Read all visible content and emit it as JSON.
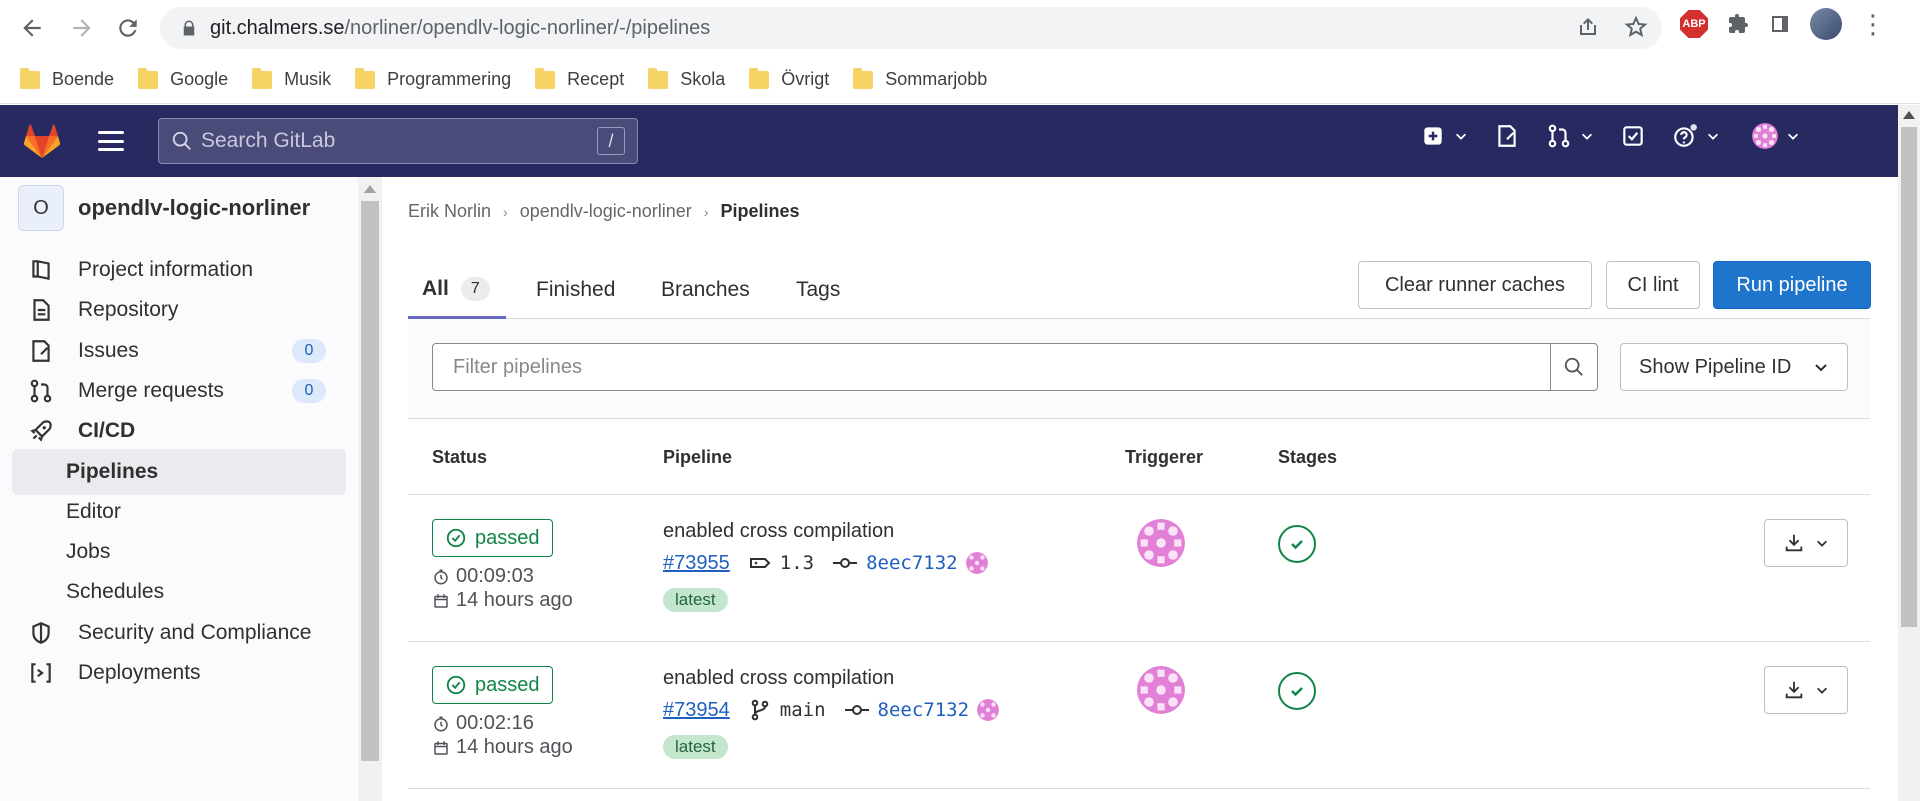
{
  "browser": {
    "url_host": "git.chalmers.se",
    "url_path": "/norliner/opendlv-logic-norliner/-/pipelines",
    "bookmarks": [
      "Boende",
      "Google",
      "Musik",
      "Programmering",
      "Recept",
      "Skola",
      "Övrigt",
      "Sommarjobb"
    ],
    "abp_label": "ABP"
  },
  "header": {
    "search_placeholder": "Search GitLab",
    "search_shortcut": "/"
  },
  "sidebar": {
    "project_initial": "O",
    "project_name": "opendlv-logic-norliner",
    "items": [
      {
        "label": "Project information",
        "icon": "project-icon"
      },
      {
        "label": "Repository",
        "icon": "doc-icon"
      },
      {
        "label": "Issues",
        "icon": "issues-icon",
        "count": "0"
      },
      {
        "label": "Merge requests",
        "icon": "merge-request-icon",
        "count": "0"
      },
      {
        "label": "CI/CD",
        "icon": "rocket-icon"
      }
    ],
    "cicd_sub": [
      "Pipelines",
      "Editor",
      "Jobs",
      "Schedules"
    ],
    "more_items": [
      {
        "label": "Security and Compliance",
        "icon": "shield-icon"
      },
      {
        "label": "Deployments",
        "icon": "deployments-icon"
      }
    ]
  },
  "breadcrumb": [
    "Erik Norlin",
    "opendlv-logic-norliner",
    "Pipelines"
  ],
  "tabs": {
    "all": "All",
    "all_count": "7",
    "finished": "Finished",
    "branches": "Branches",
    "tags": "Tags"
  },
  "actions": {
    "clear_caches": "Clear runner caches",
    "ci_lint": "CI lint",
    "run_pipeline": "Run pipeline"
  },
  "filter": {
    "placeholder": "Filter pipelines",
    "show_id": "Show Pipeline ID"
  },
  "table": {
    "headers": [
      "Status",
      "Pipeline",
      "Triggerer",
      "Stages"
    ],
    "rows": [
      {
        "status": "passed",
        "duration": "00:09:03",
        "finished": "14 hours ago",
        "commit_title": "enabled cross compilation",
        "pipeline_id": "#73955",
        "ref_type": "tag",
        "ref": "1.3",
        "sha": "8eec7132",
        "badge": "latest"
      },
      {
        "status": "passed",
        "duration": "00:02:16",
        "finished": "14 hours ago",
        "commit_title": "enabled cross compilation",
        "pipeline_id": "#73954",
        "ref_type": "branch",
        "ref": "main",
        "sha": "8eec7132",
        "badge": "latest"
      }
    ]
  },
  "colors": {
    "header_bg": "#292961",
    "success": "#108548",
    "primary": "#1f75cb",
    "avatar_pink": "#e27fd6"
  }
}
